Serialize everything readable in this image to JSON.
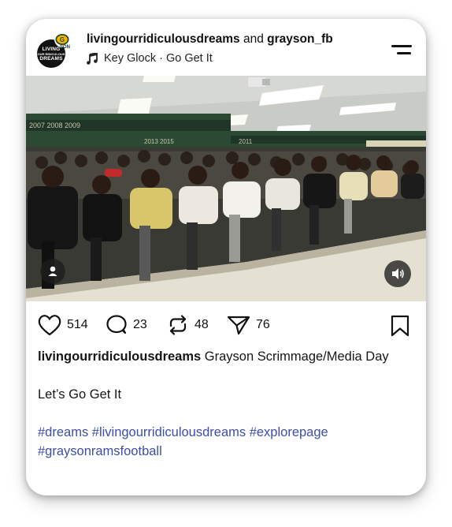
{
  "post": {
    "author": "livingourridiculousdreams",
    "and_text": "and",
    "collaborator": "grayson_fb",
    "avatar_text": [
      "LIVING",
      "OUR RIDICULOUS",
      "DREAMS"
    ],
    "badge_text": "SON",
    "music_icon": "music-note-icon",
    "music": "Key Glock · Go Get It"
  },
  "actions": {
    "likes": "514",
    "comments": "23",
    "reposts": "48",
    "shares": "76"
  },
  "caption": {
    "user": "livingourridiculousdreams",
    "text": " Grayson Scrimmage/Media Day",
    "line2": "Let’s Go Get It",
    "hashtags": "#dreams #livingourridiculousdreams #explorepage #graysonramsfootball"
  },
  "colors": {
    "hashtag": "#3c4ea8",
    "text": "#111111"
  }
}
